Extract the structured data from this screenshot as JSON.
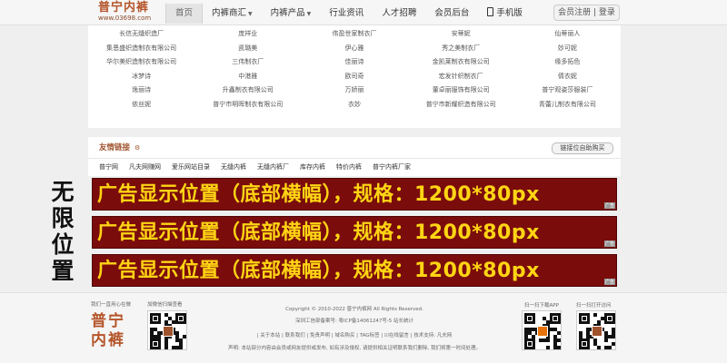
{
  "site": {
    "logo_name": "普宁内裤",
    "logo_url": "www.03698.com"
  },
  "nav": [
    {
      "label": "首页",
      "active": true
    },
    {
      "label": "内裤商汇",
      "caret": true
    },
    {
      "label": "内裤产品",
      "caret": true
    },
    {
      "label": "行业资讯"
    },
    {
      "label": "人才招聘"
    },
    {
      "label": "会员后台"
    },
    {
      "label": "手机版",
      "icon": "mobile-icon"
    }
  ],
  "login_label": "会员注册 | 登录",
  "companies": [
    "长信无缝织造厂",
    "庞祥业",
    "伟盈世家制衣厂",
    "安蒂妮",
    "仙蒂丽人",
    "集恩盛织造制衣有限公司",
    "凯璐美",
    "伊心雅",
    "秀之美制衣厂",
    "妙可妮",
    "华尔美织造制衣有限公司",
    "三伟制衣厂",
    "佳丽诗",
    "金凯莱制衣有限公司",
    "缘多拓色",
    "冰梦诗",
    "中港雅",
    "欧司奇",
    "宏发针织制衣厂",
    "倩衣妮",
    "逸丽诗",
    "升鑫制衣有限公司",
    "万娇丽",
    "董卓丽服饰有限公司",
    "普宁观姿莎服装厂",
    "依丝妮",
    "普宁市明晖制衣有限公司",
    "衣妙",
    "普宁市新耀织造有限公司",
    "青蕾儿制衣有限公司"
  ],
  "links": {
    "title": "友情链接",
    "title_icon": "settings-icon",
    "apply_label": "链接位自助购买",
    "items": [
      "普宁网",
      "凡夫网赚网",
      "爱乐网站目录",
      "无缝内裤",
      "无缝内裤厂",
      "库存内裤",
      "特价内裤",
      "普宁内裤厂家"
    ]
  },
  "side_text": [
    "无",
    "限",
    "位",
    "置"
  ],
  "ads": [
    {
      "text": "广告显示位置（底部横幅），规格：1200*80px",
      "mark": "广告"
    },
    {
      "text": "广告显示位置（底部横幅），规格：1200*80px",
      "mark": "广告"
    },
    {
      "text": "广告显示位置（底部横幅），规格：1200*80px",
      "mark": "广告"
    }
  ],
  "footer": {
    "logo_caption": "我们一直用心在做",
    "qr1_caption": "加微信扫描查看",
    "logo_text": "普宁内裤",
    "copyright": "Copyright © 2010-2022 普宁内裤网 All Rights Reserved.",
    "icp": "深圳工信部备案号: 粤ICP备14061247号-5  站长统计",
    "links_line": "| 关于本站 | 联系我们 | 免责声明 | 域名购买 | TAG标签 | ☑在线留言 | 技术支持: 凡夫网",
    "notice": "声明: 本站部分内容由会员或网友提供或发布, 如有涉及侵权, 请提供相关证明联系我们删除, 我们将第一时间处理。",
    "qr2_caption": "扫一扫下载APP",
    "qr3_caption": "扫一扫打开访问"
  },
  "colors": {
    "ad_bg": "#7b0c0c",
    "ad_text": "#ffd514",
    "brand": "#b4552a"
  }
}
